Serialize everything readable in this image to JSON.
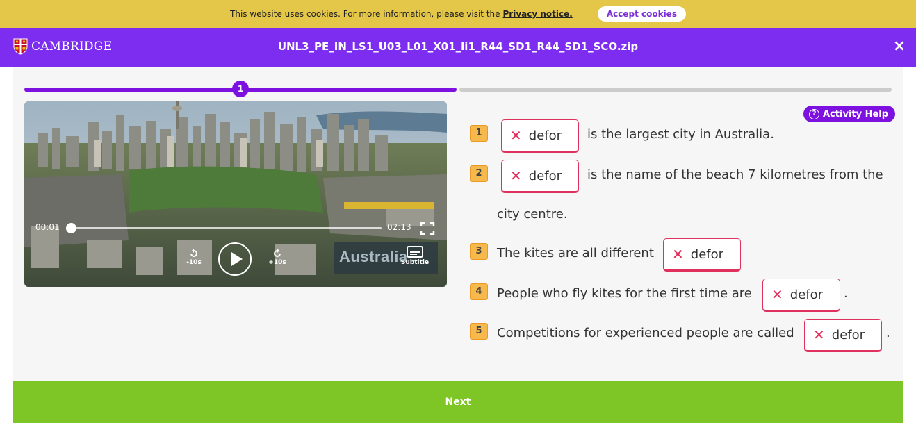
{
  "cookie_bar": {
    "message": "This website uses cookies. For more information, please visit the",
    "privacy_link": "Privacy notice.",
    "accept_label": "Accept cookies"
  },
  "header": {
    "brand": "CAMBRIDGE",
    "file_title": "UNL3_PE_IN_LS1_U03_L01_X01_li1_R44_SD1_R44_SD1_SCO.zip",
    "close_label": "×"
  },
  "progress": {
    "current_step": "1",
    "fraction_complete": 0.5
  },
  "video": {
    "current_time": "00:01",
    "duration": "02:13",
    "rewind_label": "-10s",
    "forward_label": "+10s",
    "subtitle_label": "Subtitle",
    "scene_sign_text": "Australia",
    "playback_fraction": 0.01
  },
  "activity_help_label": "Activity Help",
  "questions": [
    {
      "number": "1",
      "answer": "defor",
      "text_after": "is the largest city in Australia."
    },
    {
      "number": "2",
      "answer": "defor",
      "text_after": "is the name of the beach 7 kilometres from the",
      "text_continued": "city centre."
    },
    {
      "number": "3",
      "text_before": "The kites are all different",
      "answer": "defor"
    },
    {
      "number": "4",
      "text_before": "People who fly kites for the first time are",
      "answer": "defor",
      "text_after": "."
    },
    {
      "number": "5",
      "text_before": "Competitions for experienced people are called",
      "answer": "defor",
      "text_after": "."
    }
  ],
  "next_label": "Next",
  "colors": {
    "cookie_bar": "#e4c649",
    "brand_purple": "#7d2df0",
    "accent_purple": "#7d12e0",
    "wrong_red": "#e0305d",
    "number_badge": "#f7b84c",
    "next_green": "#7ec526"
  }
}
